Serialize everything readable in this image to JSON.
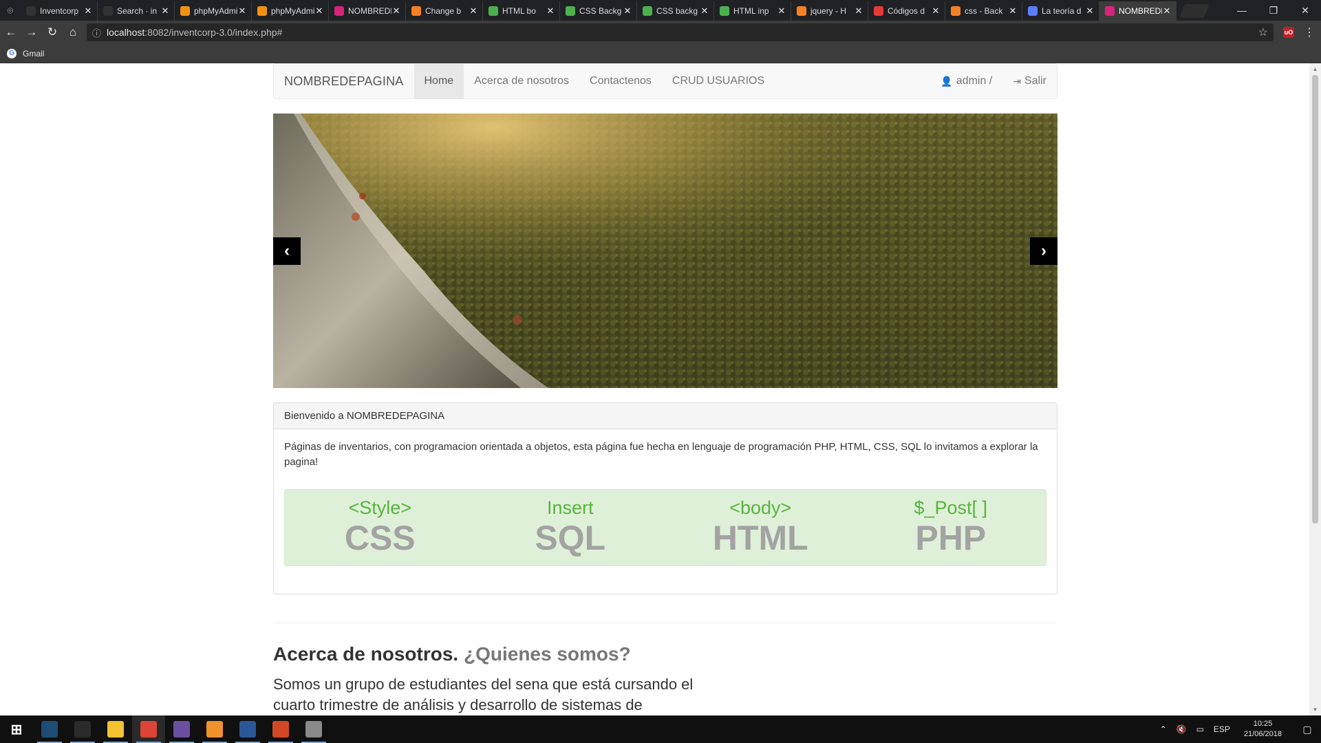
{
  "browser": {
    "tabs": [
      {
        "label": "Inventcorp",
        "icon": "github-icon",
        "color": "#333333"
      },
      {
        "label": "Search · in",
        "icon": "github-icon",
        "color": "#333333"
      },
      {
        "label": "phpMyAdmin",
        "icon": "phpmyadmin-icon",
        "color": "#f29111"
      },
      {
        "label": "phpMyAdmin",
        "icon": "phpmyadmin-icon",
        "color": "#f29111"
      },
      {
        "label": "NOMBREDEPAGINA",
        "icon": "page-icon",
        "color": "#d6247a"
      },
      {
        "label": "Change b",
        "icon": "page-icon",
        "color": "#f48024"
      },
      {
        "label": "HTML bo",
        "icon": "w3schools-icon",
        "color": "#4caf50"
      },
      {
        "label": "CSS Backg",
        "icon": "w3schools-icon",
        "color": "#4caf50"
      },
      {
        "label": "CSS backg",
        "icon": "w3schools-icon",
        "color": "#4caf50"
      },
      {
        "label": "HTML inp",
        "icon": "w3schools-icon",
        "color": "#4caf50"
      },
      {
        "label": "jquery - H",
        "icon": "stackoverflow-icon",
        "color": "#f48024"
      },
      {
        "label": "Códigos d",
        "icon": "page-icon",
        "color": "#e53935"
      },
      {
        "label": "css - Back",
        "icon": "stackoverflow-icon",
        "color": "#f48024"
      },
      {
        "label": "La teoría d",
        "icon": "page-icon",
        "color": "#5c7cfa"
      },
      {
        "label": "NOMBREDEPAGINA",
        "icon": "page-icon",
        "color": "#d6247a",
        "active": true
      }
    ],
    "url_host": "localhost",
    "url_rest": ":8082/inventcorp-3.0/index.php#",
    "bookmark_gmail": "Gmail"
  },
  "navbar": {
    "brand": "NOMBREDEPAGINA",
    "links": [
      "Home",
      "Acerca de nosotros",
      "Contactenos",
      "CRUD USUARIOS"
    ],
    "user": "admin /",
    "logout": "Salir"
  },
  "carousel": {
    "prev_label": "‹",
    "next_label": "›"
  },
  "welcome_panel": {
    "heading": "Bienvenido a NOMBREDEPAGINA",
    "body": "Páginas de inventarios, con programacion orientada a objetos, esta página fue hecha en lenguaje de programación PHP, HTML, CSS, SQL lo invitamos a explorar la pagina!",
    "technologies": [
      {
        "code": "<Style>",
        "name": "CSS"
      },
      {
        "code": "Insert",
        "name": "SQL"
      },
      {
        "code": "<body>",
        "name": "HTML"
      },
      {
        "code": "$_Post[ ]",
        "name": "PHP"
      }
    ]
  },
  "about": {
    "title": "Acerca de nosotros.",
    "subtitle": "¿Quienes somos?",
    "text": "Somos un grupo de estudiantes del sena que está cursando el cuarto trimestre de análisis y desarrollo de sistemas de"
  },
  "taskbar": {
    "apps": [
      {
        "name": "windows-start-icon",
        "color": "#101010"
      },
      {
        "name": "mysql-workbench-icon",
        "color": "#1d4d74"
      },
      {
        "name": "vnc-icon",
        "color": "#2b2b2b"
      },
      {
        "name": "file-explorer-icon",
        "color": "#f2c230"
      },
      {
        "name": "chrome-icon",
        "color": "#db4437"
      },
      {
        "name": "app-icon",
        "color": "#6a4fa0"
      },
      {
        "name": "sublime-text-icon",
        "color": "#f2922a"
      },
      {
        "name": "word-icon",
        "color": "#2b579a"
      },
      {
        "name": "powerpoint-icon",
        "color": "#d24726"
      },
      {
        "name": "app-icon",
        "color": "#8a8a8a"
      }
    ],
    "language": "ESP",
    "time": "10:25",
    "date": "21/06/2018"
  }
}
